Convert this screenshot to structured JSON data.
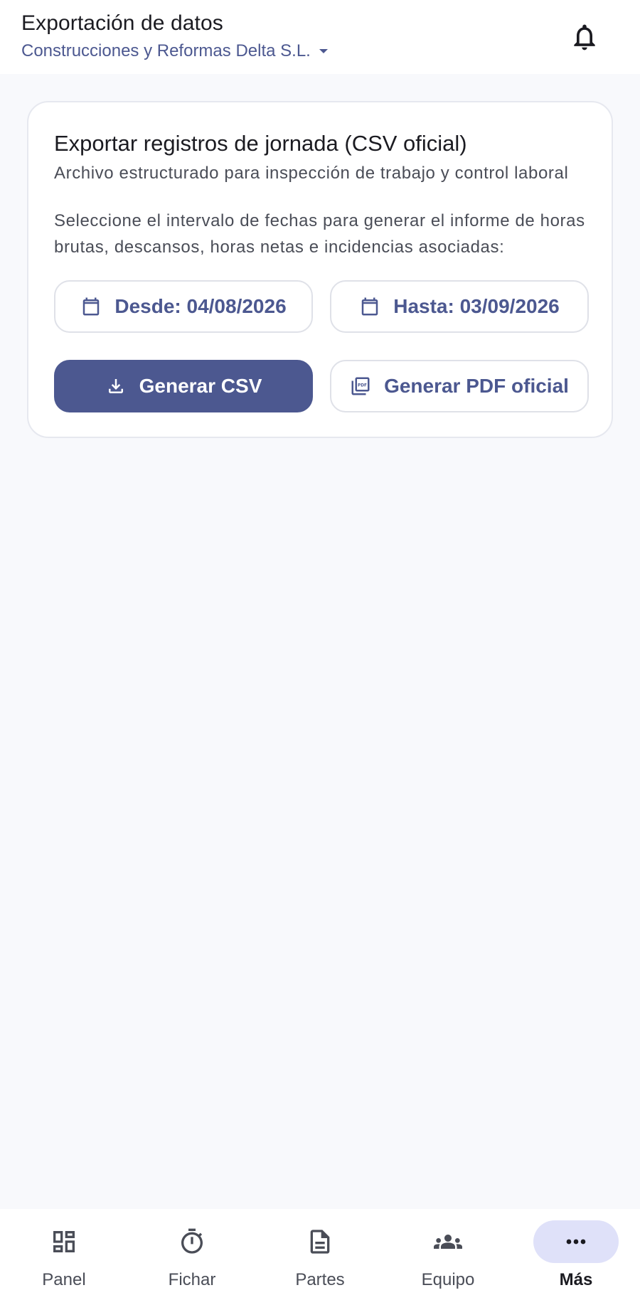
{
  "header": {
    "title": "Exportación de datos",
    "company": "Construcciones y Reformas Delta S.L."
  },
  "card": {
    "heading": "Exportar registros de jornada (CSV oficial)",
    "subtitle": "Archivo estructurado para inspección de trabajo y control laboral",
    "description": "Seleccione el intervalo de fechas para generar el informe de horas brutas, descansos, horas netas e incidencias asociadas:",
    "date_from_label": "Desde: 04/08/2026",
    "date_to_label": "Hasta: 03/09/2026",
    "generate_csv_label": "Generar CSV",
    "generate_pdf_label": "Generar PDF oficial"
  },
  "bottom_nav": {
    "items": [
      {
        "label": "Panel",
        "icon": "dashboard-icon"
      },
      {
        "label": "Fichar",
        "icon": "timer-icon"
      },
      {
        "label": "Partes",
        "icon": "document-icon"
      },
      {
        "label": "Equipo",
        "icon": "group-icon"
      },
      {
        "label": "Más",
        "icon": "more-horizontal-icon",
        "active": true
      }
    ]
  },
  "colors": {
    "primary": "#4c5890",
    "active_pill": "#dfe1f9",
    "text": "#1b1b21",
    "muted_text": "#4a4d57",
    "background": "#f8f9fc"
  }
}
